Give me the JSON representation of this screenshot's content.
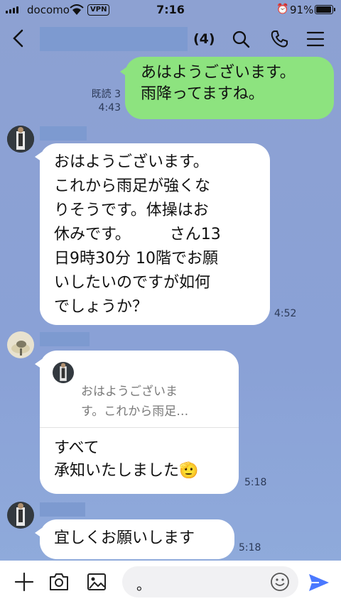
{
  "status_bar": {
    "carrier": "docomo",
    "vpn": "VPN",
    "time": "7:16",
    "battery": "91%"
  },
  "header": {
    "member_count": "(4)"
  },
  "messages": {
    "m1": {
      "line1": "あはようございます。",
      "line2": "雨降ってますね。",
      "read": "既読 3",
      "time": "4:43"
    },
    "m2": {
      "lines": [
        "おはようございます。",
        "これから雨足が強くな",
        "りそうです。体操はお",
        "休みです。　　　さん13",
        "日9時30分 10階でお願",
        "いしたいのですが如何",
        "でしょうか？"
      ],
      "time": "4:52"
    },
    "m3": {
      "quote_line1": "おはようございま",
      "quote_line2": "す。これから雨足…",
      "line1": "すべて",
      "line2": "承知いたしました",
      "emoji": "🫡",
      "time": "5:18"
    },
    "m4": {
      "text": "宜しくお願いします",
      "time": "5:18"
    }
  },
  "input": {
    "value": "。"
  },
  "colors": {
    "background": "#8da1d2",
    "outgoing_bubble": "#8de37f",
    "incoming_bubble": "#ffffff",
    "send_icon": "#4a78ff"
  }
}
